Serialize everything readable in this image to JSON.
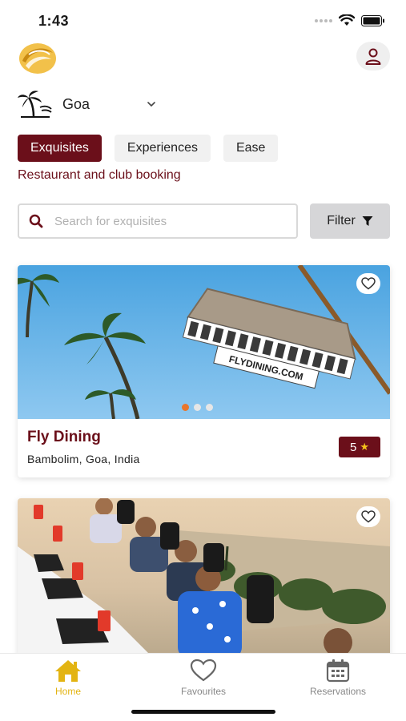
{
  "status": {
    "time": "1:43"
  },
  "location": {
    "name": "Goa"
  },
  "tabs": [
    {
      "label": "Exquisites",
      "active": true
    },
    {
      "label": "Experiences",
      "active": false
    },
    {
      "label": "Ease",
      "active": false
    }
  ],
  "tab_description": "Restaurant and club booking",
  "search": {
    "placeholder": "Search for exquisites",
    "value": ""
  },
  "filter": {
    "label": "Filter"
  },
  "cards": [
    {
      "title": "Fly Dining",
      "location": "Bambolim, Goa, India",
      "rating": "5",
      "image_text": "FLYDINING.COM",
      "carousel_dots": 3,
      "active_dot": 0
    },
    {
      "title": "",
      "location": "",
      "rating": ""
    }
  ],
  "nav": {
    "home": "Home",
    "favourites": "Favourites",
    "reservations": "Reservations"
  },
  "colors": {
    "brand": "#6b0f1a",
    "active_nav": "#e3b412",
    "carousel_active": "#e8762c"
  },
  "icons": [
    "logo-icon",
    "profile-icon",
    "palm-tree-icon",
    "chevron-down-icon",
    "search-icon",
    "filter-icon",
    "heart-icon",
    "star-icon",
    "home-icon",
    "calendar-icon"
  ]
}
